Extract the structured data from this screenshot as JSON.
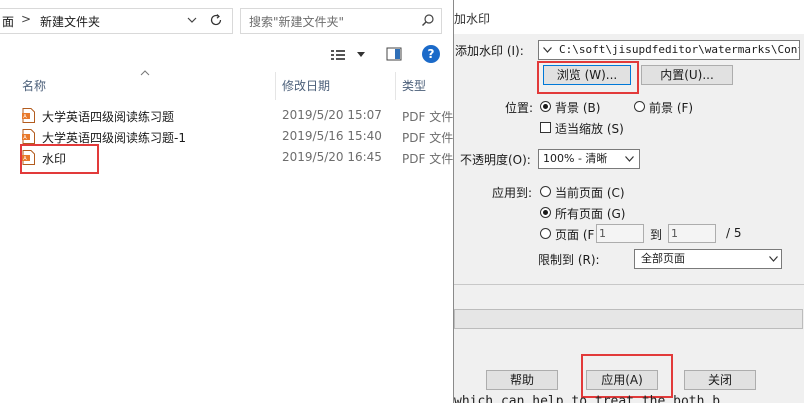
{
  "explorer": {
    "address": {
      "segment_partial": "面",
      "separator": ">",
      "current_folder": "新建文件夹"
    },
    "search": {
      "placeholder": "搜索\"新建文件夹\""
    },
    "columns": {
      "name": "名称",
      "date": "修改日期",
      "type": "类型"
    },
    "files": [
      {
        "name": "大学英语四级阅读练习题",
        "date": "2019/5/20 15:07",
        "type": "PDF 文件"
      },
      {
        "name": "大学英语四级阅读练习题-1",
        "date": "2019/5/16 15:40",
        "type": "PDF 文件"
      },
      {
        "name": "水印",
        "date": "2019/5/20 16:45",
        "type": "PDF 文件"
      }
    ],
    "help_glyph": "?"
  },
  "dialog": {
    "title": "加水印",
    "add_watermark_label": "添加水印 (I):",
    "watermark_path": "C:\\soft\\jisupdfeditor\\watermarks\\Confide",
    "browse_button": "浏览 (W)...",
    "builtin_button": "内置(U)...",
    "position_label": "位置:",
    "background_option": "背景 (B)",
    "foreground_option": "前景 (F)",
    "fit_scale_option": "适当缩放 (S)",
    "opacity_label": "不透明度(O):",
    "opacity_value": "100% - 清晰",
    "apply_to_label": "应用到:",
    "current_page_option": "当前页面 (C)",
    "all_pages_option": "所有页面 (G)",
    "page_range_option": "页面 (F",
    "page_from": "1",
    "page_to_label": "到",
    "page_to": "1",
    "page_total": "/  5",
    "limit_to_label": "限制到 (R):",
    "limit_to_value": "全部页面",
    "help_button": "帮助",
    "apply_button": "应用(A)",
    "close_button": "关闭",
    "bottom_overflow_text": "which can help to treat the both b"
  },
  "colors": {
    "highlight_red": "#e23a3a",
    "accent_blue": "#0078d7",
    "pdf_icon": "#e8792b"
  }
}
